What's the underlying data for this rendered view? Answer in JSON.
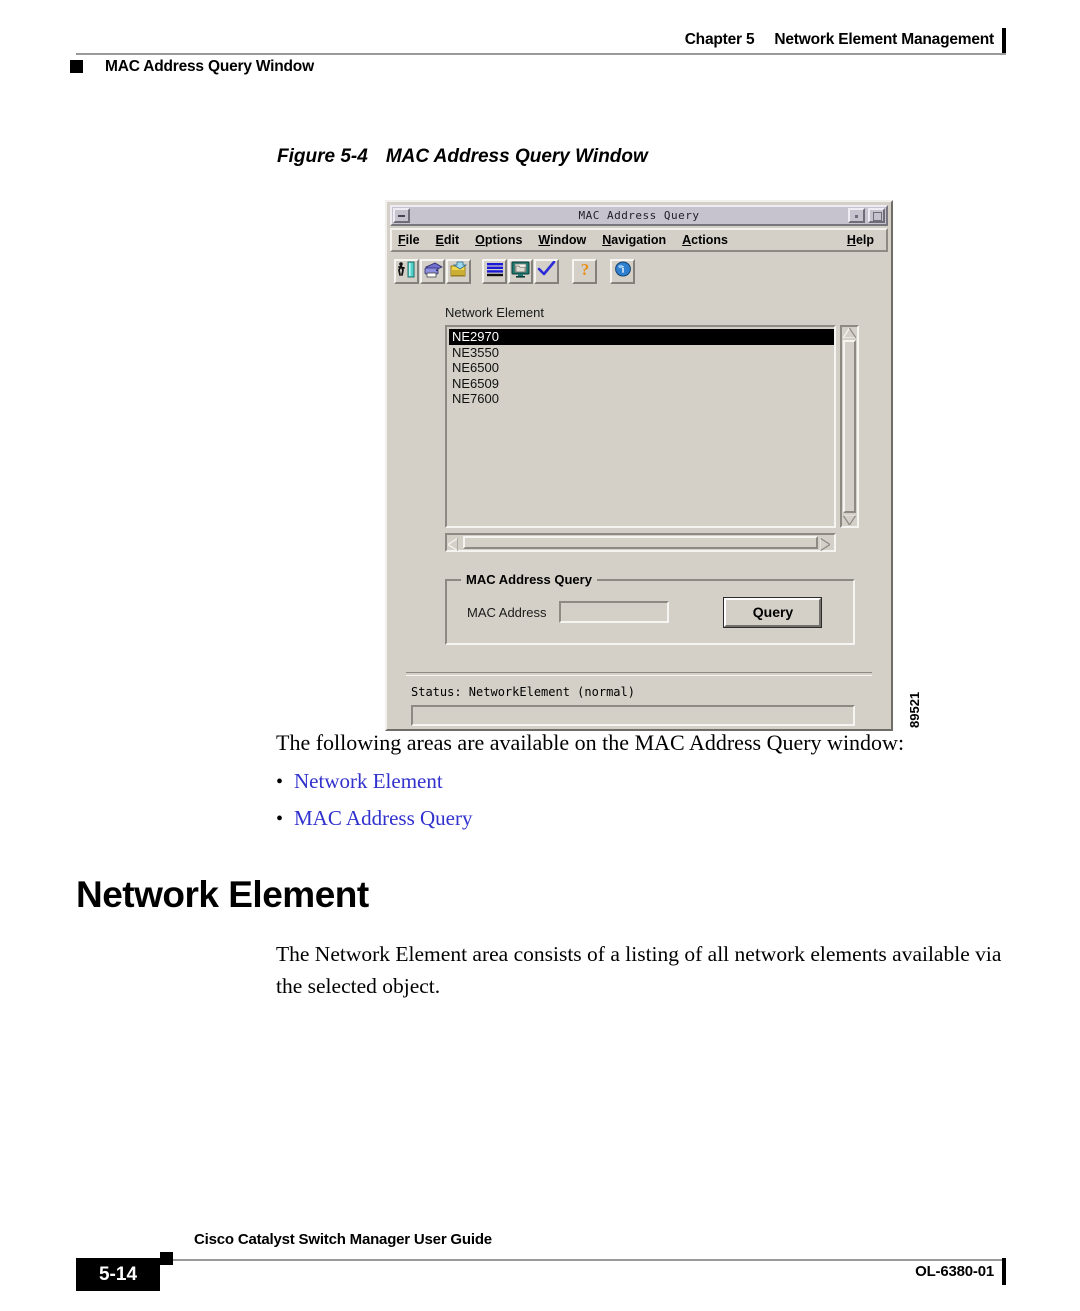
{
  "header": {
    "chapter_label": "Chapter 5",
    "chapter_title": "Network Element Management",
    "running_head": "MAC Address Query Window"
  },
  "figure": {
    "number": "Figure 5-4",
    "title": "MAC Address Query Window",
    "art_id": "89521"
  },
  "dialog": {
    "title": "MAC Address Query",
    "menus": [
      {
        "mnemonic": "F",
        "rest": "ile"
      },
      {
        "mnemonic": "E",
        "rest": "dit"
      },
      {
        "mnemonic": "O",
        "rest": "ptions"
      },
      {
        "mnemonic": "W",
        "rest": "indow"
      },
      {
        "mnemonic": "N",
        "rest": "avigation"
      },
      {
        "mnemonic": "A",
        "rest": "ctions"
      }
    ],
    "help_menu": {
      "mnemonic": "H",
      "rest": "elp"
    },
    "toolbar_icons": [
      "exit-door-icon",
      "print-icon",
      "paste-icon",
      "list-view-icon",
      "open-monitor-icon",
      "checkmark-icon",
      "help-question-icon",
      "info-icon"
    ],
    "network_element": {
      "label": "Network Element",
      "items": [
        "NE2970",
        "NE3550",
        "NE6500",
        "NE6509",
        "NE7600"
      ],
      "selected": "NE2970"
    },
    "mac_group": {
      "title": "MAC Address Query",
      "field_label": "MAC Address",
      "field_value": "",
      "button_label": "Query"
    },
    "status": {
      "text": "Status: NetworkElement (normal)",
      "message_value": ""
    }
  },
  "body": {
    "intro": "The following areas are available on the MAC Address Query window:",
    "bullet_marker": "•",
    "links": [
      "Network Element",
      "MAC Address Query"
    ],
    "heading": "Network Element",
    "paragraph": "The Network Element area consists of a listing of all network elements available via the selected object."
  },
  "footer": {
    "page_number": "5-14",
    "guide_title": "Cisco Catalyst Switch Manager User Guide",
    "doc_id": "OL-6380-01"
  },
  "colors": {
    "link": "#3131cd",
    "dialog_face": "#d4d0c8",
    "titlebar": "#c6c3ce",
    "selection": "#000000"
  }
}
